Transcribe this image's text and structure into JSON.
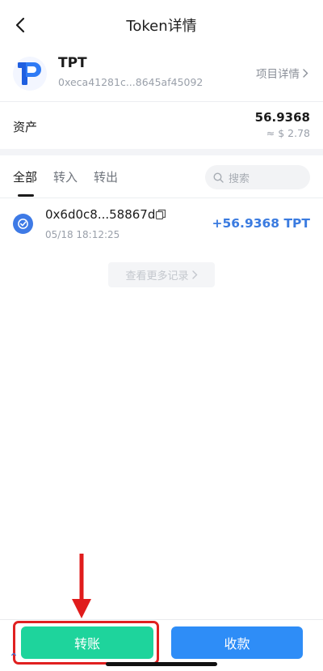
{
  "header": {
    "title": "Token详情"
  },
  "token": {
    "symbol": "TPT",
    "address": "0xeca41281c...8645af45092",
    "project_detail_label": "项目详情"
  },
  "asset": {
    "label": "资产",
    "amount": "56.9368",
    "usd_value": "≈ $ 2.78"
  },
  "tabs": [
    {
      "label": "全部",
      "active": true
    },
    {
      "label": "转入",
      "active": false
    },
    {
      "label": "转出",
      "active": false
    }
  ],
  "search": {
    "placeholder": "搜索"
  },
  "transactions": [
    {
      "hash": "0x6d0c8...58867d",
      "time": "05/18 18:12:25",
      "amount": "+56.9368 TPT"
    }
  ],
  "more_records_label": "查看更多记录",
  "actions": {
    "transfer_label": "转账",
    "receive_label": "收款"
  },
  "colors": {
    "accent_blue": "#3a7be0",
    "transfer_green": "#1ed49c",
    "receive_blue": "#2e8df7",
    "highlight_red": "#e02020"
  },
  "icons": {
    "back": "back-arrow-icon",
    "token_logo": "tpt-logo-icon",
    "chevron": "chevron-right-icon",
    "search": "search-icon",
    "tx_status": "check-circle-icon",
    "copy": "copy-icon",
    "annotation": "red-arrow-icon"
  }
}
